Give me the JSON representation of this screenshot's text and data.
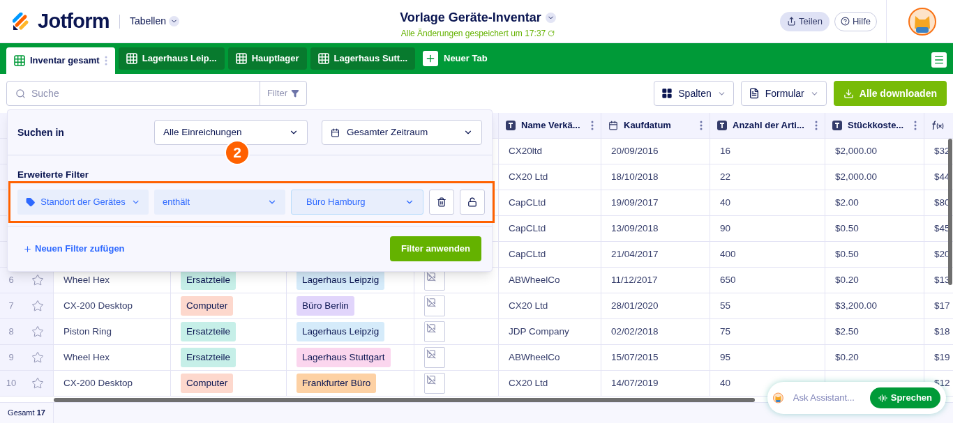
{
  "header": {
    "logo": "Jotform",
    "section": "Tabellen",
    "title": "Vorlage Geräte-Inventar",
    "status": "Alle Änderungen gespeichert um 17:37",
    "share": "Teilen",
    "help": "Hilfe"
  },
  "tabs": [
    {
      "label": "Inventar gesamt",
      "selected": true
    },
    {
      "label": "Lagerhaus Leip...",
      "selected": false
    },
    {
      "label": "Hauptlager",
      "selected": false
    },
    {
      "label": "Lagerhaus Sutt...",
      "selected": false
    }
  ],
  "new_tab": "Neuer Tab",
  "toolbar": {
    "search": {
      "placeholder": "Suche"
    },
    "filter": "Filter",
    "columns": "Spalten",
    "form": "Formular",
    "download": "Alle downloaden"
  },
  "filter_panel": {
    "search_in_label": "Suchen in",
    "scope": "Alle Einreichungen",
    "period": "Gesamter Zeitraum",
    "advanced_label": "Erweiterte Filter",
    "step_badge": "2",
    "rule": {
      "field": "Standort der Gerätes",
      "operator": "enthält",
      "value": "Büro Hamburg",
      "locked": false
    },
    "add_filter": "Neuen Filter zufügen",
    "apply": "Filter anwenden"
  },
  "table": {
    "columns": [
      {
        "label": "Name Verkä...",
        "kind": "text"
      },
      {
        "label": "Kaufdatum",
        "kind": "date"
      },
      {
        "label": "Anzahl der Arti...",
        "kind": "text"
      },
      {
        "label": "Stückkoste...",
        "kind": "text"
      },
      {
        "kind": "formula"
      }
    ],
    "rows": [
      {
        "vendor": "CX20ltd",
        "date": "20/09/2016",
        "count": "16",
        "price": "$2,000.00",
        "total": "$32"
      },
      {
        "vendor": "CX20 Ltd",
        "date": "18/10/2018",
        "count": "22",
        "price": "$2,000.00",
        "total": "$44"
      },
      {
        "vendor": "CapCLtd",
        "date": "19/09/2017",
        "count": "40",
        "price": "$2.00",
        "total": "$80"
      },
      {
        "vendor": "CapCLtd",
        "date": "13/09/2018",
        "count": "90",
        "price": "$0.50",
        "total": "$45"
      },
      {
        "vendor": "CapCLtd",
        "date": "21/04/2017",
        "count": "400",
        "price": "$0.50",
        "total": "$20"
      },
      {
        "number": "6",
        "starred": false,
        "name": "Wheel Hex",
        "category": {
          "text": "Ersatzteile",
          "color": "#c6efe8"
        },
        "location": {
          "text": "Lagerhaus Leipzig",
          "color": "#d5ebfa"
        },
        "image": true,
        "vendor": "ABWheelCo",
        "date": "11/12/2017",
        "count": "650",
        "price": "$0.20",
        "total": "$13"
      },
      {
        "number": "7",
        "starred": false,
        "name": "CX-200 Desktop",
        "category": {
          "text": "Computer",
          "color": "#fdd8cd"
        },
        "location": {
          "text": "Büro Berlin",
          "color": "#e1d5fb"
        },
        "image": true,
        "vendor": "CX20 Ltd",
        "date": "28/01/2020",
        "count": "55",
        "price": "$3,200.00",
        "total": "$17"
      },
      {
        "number": "8",
        "starred": false,
        "name": "Piston Ring",
        "category": {
          "text": "Ersatzteile",
          "color": "#c6efe8"
        },
        "location": {
          "text": "Lagerhaus Leipzig",
          "color": "#d5ebfa"
        },
        "image": true,
        "vendor": "JDP Company",
        "date": "02/02/2018",
        "count": "75",
        "price": "$2.50",
        "total": "$18"
      },
      {
        "number": "9",
        "starred": false,
        "name": "Wheel Hex",
        "category": {
          "text": "Ersatzteile",
          "color": "#c6efe8"
        },
        "location": {
          "text": "Lagerhaus Stuttgart",
          "color": "#fbd6ee"
        },
        "image": true,
        "vendor": "ABWheelCo",
        "date": "15/07/2015",
        "count": "95",
        "price": "$0.20",
        "total": "$19"
      },
      {
        "number": "10",
        "starred": false,
        "name": "CX-200 Desktop",
        "category": {
          "text": "Computer",
          "color": "#fdd8cd"
        },
        "location": {
          "text": "Frankfurter Büro",
          "color": "#fdd1a4"
        },
        "image": true,
        "vendor": "CX20 Ltd",
        "date": "14/07/2019",
        "count": "40",
        "total": "$12"
      }
    ],
    "footer": "Gesamt **17**"
  },
  "assistant": {
    "placeholder": "Ask Assistant...",
    "talk": "Sprechen"
  }
}
